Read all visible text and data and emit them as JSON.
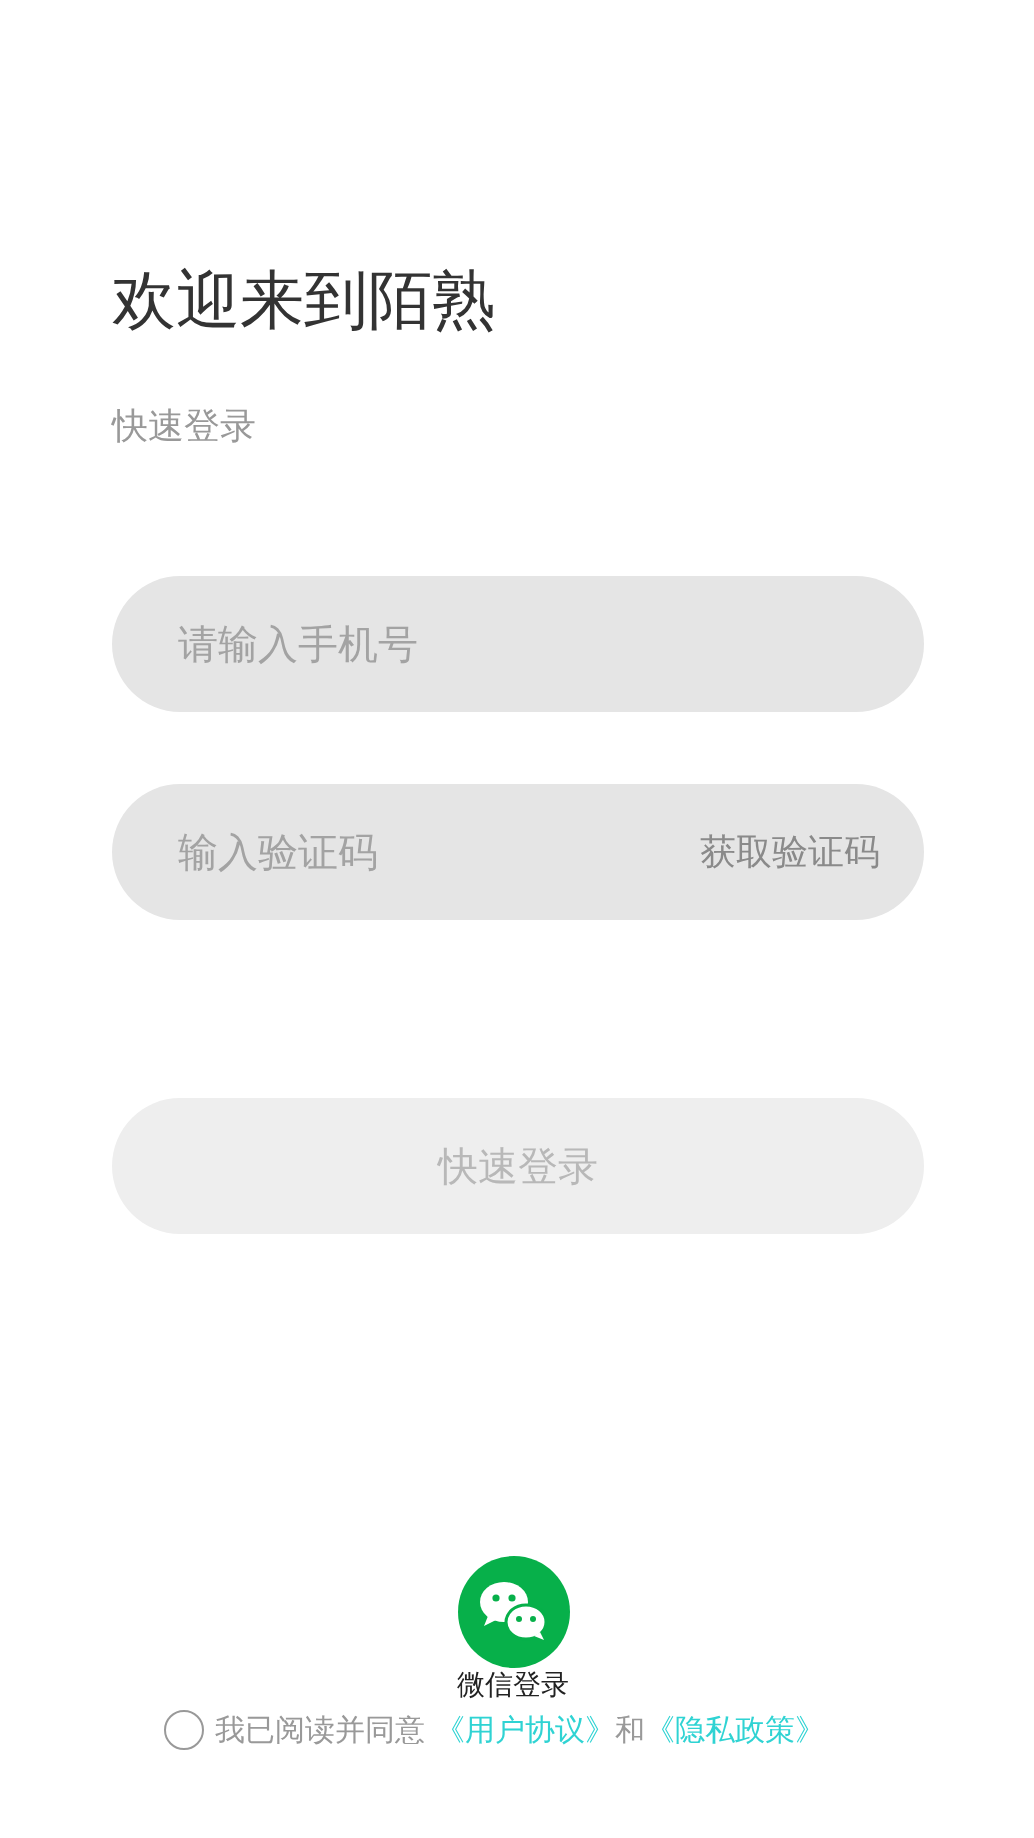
{
  "title": "欢迎来到陌熟",
  "subtitle": "快速登录",
  "phone_field": {
    "placeholder": "请输入手机号"
  },
  "code_field": {
    "placeholder": "输入验证码",
    "action": "获取验证码"
  },
  "login_button": {
    "label": "快速登录",
    "disabled": true
  },
  "wechat_login": {
    "label": "微信登录"
  },
  "agreement": {
    "checked": false,
    "text": "我已阅读并同意",
    "user_agreement": "《用户协议》",
    "conjunction": "和",
    "privacy_policy": "《隐私政策》"
  }
}
